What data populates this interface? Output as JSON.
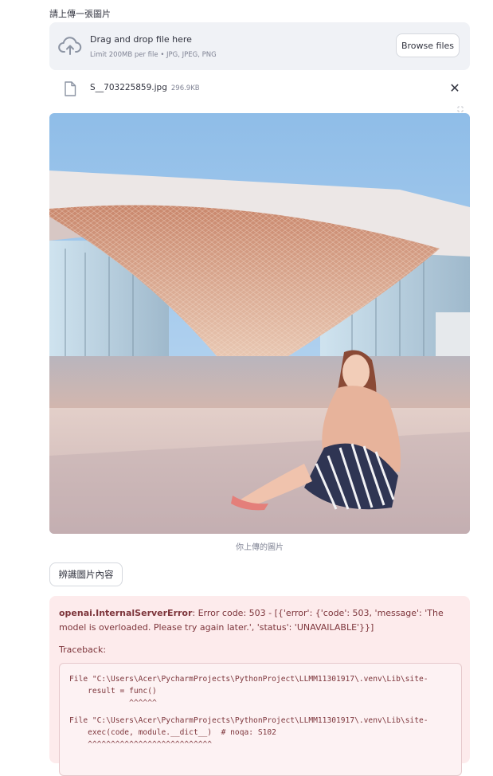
{
  "uploader": {
    "label": "請上傳一張圖片",
    "drop_title": "Drag and drop file here",
    "drop_limit": "Limit 200MB per file • JPG, JPEG, PNG",
    "browse_label": "Browse files",
    "icon": "cloud-upload-icon"
  },
  "file": {
    "name": "S__703225859.jpg",
    "size": "296.9KB",
    "close_glyph": "✕"
  },
  "image": {
    "caption": "你上傳的圖片"
  },
  "actions": {
    "recognize_label": "辨識圖片內容"
  },
  "error": {
    "type": "openai.InternalServerError",
    "message": ": Error code: 503 - [{'error': {'code': 503, 'message': 'The model is overloaded. Please try again later.', 'status': 'UNAVAILABLE'}}]",
    "traceback_label": "Traceback:",
    "code_lines": [
      "File \"C:\\Users\\Acer\\PycharmProjects\\PythonProject\\LLMM11301917\\.venv\\Lib\\site-",
      "    result = func()",
      "             ^^^^^^",
      "File \"C:\\Users\\Acer\\PycharmProjects\\PythonProject\\LLMM11301917\\.venv\\Lib\\site-",
      "    exec(code, module.__dict__)  # noqa: S102",
      "    ^^^^^^^^^^^^^^^^^^^^^^^^^^^"
    ]
  },
  "colors": {
    "error_bg": "#fdebec",
    "error_text": "#7d353b",
    "dropzone_bg": "#f0f2f6"
  }
}
